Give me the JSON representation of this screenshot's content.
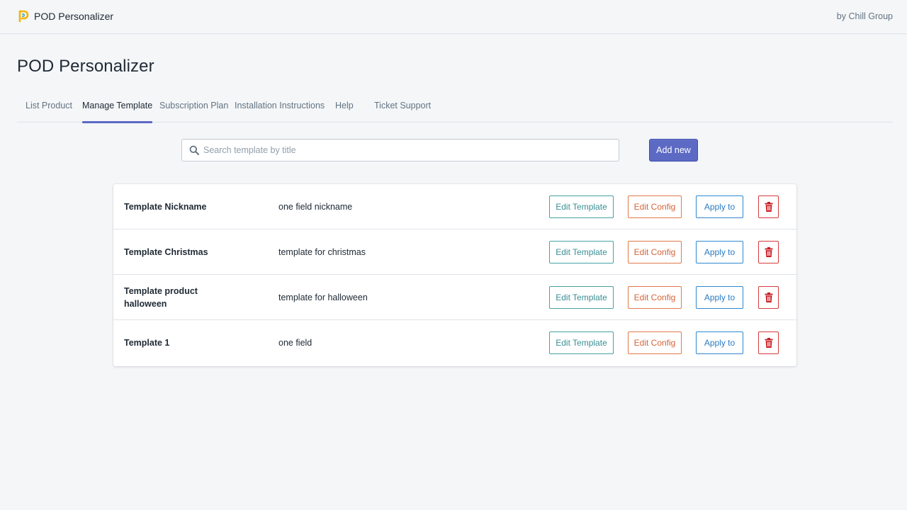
{
  "header": {
    "app_name": "POD Personalizer",
    "byline": "by Chill Group",
    "logo_icon": "pod-logo-icon"
  },
  "page": {
    "title": "POD Personalizer"
  },
  "tabs": [
    {
      "label": "List Product",
      "active": false
    },
    {
      "label": "Manage Template",
      "active": true
    },
    {
      "label": "Subscription Plan",
      "active": false
    },
    {
      "label": "Installation Instructions",
      "active": false
    },
    {
      "label": "Help",
      "active": false
    },
    {
      "label": "Ticket Support",
      "active": false
    }
  ],
  "search": {
    "value": "",
    "placeholder": "Search template by title",
    "icon": "search-icon"
  },
  "actions": {
    "add_new_label": "Add new"
  },
  "templates": [
    {
      "title": "Template Nickname",
      "description": "one field nickname"
    },
    {
      "title": "Template Christmas",
      "description": "template for christmas"
    },
    {
      "title": "Template product halloween",
      "description": "template for halloween"
    },
    {
      "title": "Template 1",
      "description": "one field"
    }
  ],
  "row_actions": {
    "edit_template_label": "Edit Template",
    "edit_config_label": "Edit Config",
    "apply_label": "Apply to",
    "delete_icon": "trash-icon"
  },
  "colors": {
    "accent": "#5c6ac4",
    "edit_template": "#47a1a6",
    "edit_config": "#e0794b",
    "apply": "#2f88cf",
    "delete": "#c4161c"
  }
}
